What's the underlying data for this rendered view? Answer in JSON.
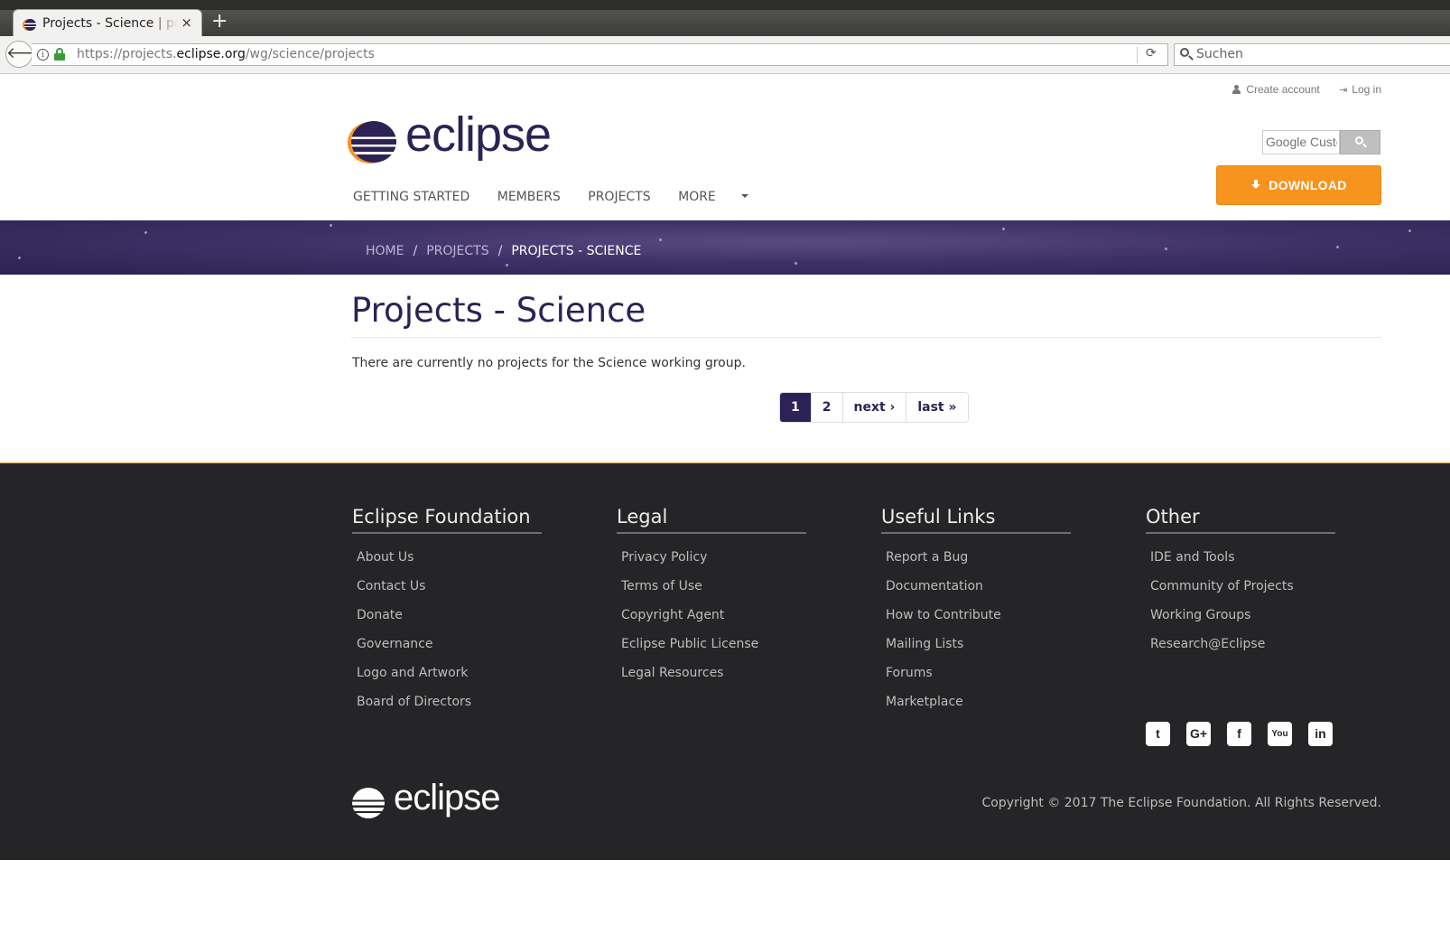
{
  "browser": {
    "tab_title": "Projects - Science | projects.eclipse.org",
    "new_tab_label": "+",
    "close_label": "×",
    "url_prefix": "https://projects.",
    "url_domain": "eclipse.org",
    "url_path": "/wg/science/projects",
    "search_placeholder": "Suchen"
  },
  "toplinks": {
    "create_account": "Create account",
    "log_in": "Log in"
  },
  "header": {
    "logo_text": "eclipse",
    "search_placeholder": "Google Custom Search",
    "download_label": "DOWNLOAD",
    "nav": [
      "GETTING STARTED",
      "MEMBERS",
      "PROJECTS",
      "MORE"
    ]
  },
  "breadcrumb": {
    "home": "HOME",
    "projects": "PROJECTS",
    "current": "PROJECTS - SCIENCE",
    "separator": "/"
  },
  "main": {
    "title": "Projects - Science",
    "intro": "There are currently no projects for the Science working group.",
    "pager": [
      "1",
      "2",
      "next ›",
      "last »"
    ]
  },
  "footer": {
    "columns": [
      {
        "heading": "Eclipse Foundation",
        "links": [
          "About Us",
          "Contact Us",
          "Donate",
          "Governance",
          "Logo and Artwork",
          "Board of Directors"
        ]
      },
      {
        "heading": "Legal",
        "links": [
          "Privacy Policy",
          "Terms of Use",
          "Copyright Agent",
          "Eclipse Public License",
          "Legal Resources"
        ]
      },
      {
        "heading": "Useful Links",
        "links": [
          "Report a Bug",
          "Documentation",
          "How to Contribute",
          "Mailing Lists",
          "Forums",
          "Marketplace"
        ]
      },
      {
        "heading": "Other",
        "links": [
          "IDE and Tools",
          "Community of Projects",
          "Working Groups",
          "Research@Eclipse"
        ]
      }
    ],
    "social": [
      "twitter-icon",
      "google-plus-icon",
      "facebook-icon",
      "youtube-icon",
      "linkedin-icon"
    ],
    "logo_text": "eclipse",
    "copyright": "Copyright © 2017 The Eclipse Foundation. All Rights Reserved."
  },
  "colors": {
    "brand_purple": "#2c2255",
    "accent_orange": "#f7941e",
    "footer_bg": "#252527"
  }
}
